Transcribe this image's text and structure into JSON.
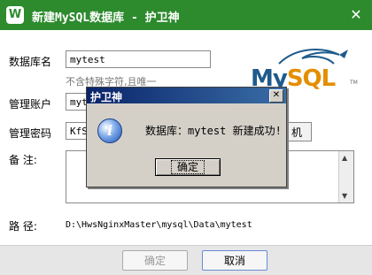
{
  "window": {
    "title": "新建MySQL数据库 - 护卫神",
    "logo_glyph": "W",
    "close_glyph": "✕"
  },
  "form": {
    "db_name_label": "数据库名",
    "db_name_value": "mytest",
    "db_name_hint": "不含特殊字符,且唯一",
    "user_label": "管理账户",
    "user_value": "myte",
    "password_label": "管理密码",
    "password_value": "KfS",
    "generate_label": "机",
    "remark_label": "备  注:",
    "path_label": "路  径:",
    "path_value": "D:\\HwsNginxMaster\\mysql\\Data\\mytest"
  },
  "logo": {
    "my": "My",
    "sql": "SQL",
    "tm": "TM"
  },
  "buttons": {
    "ok": "确定",
    "cancel": "取消"
  },
  "dialog": {
    "title": "护卫神",
    "message": "数据库：mytest 新建成功!",
    "ok": "确定",
    "icon": "info-icon",
    "close_glyph": "✕"
  },
  "colors": {
    "titlebar": "#2d8a2d",
    "dialog_title": "#0a246a",
    "mysql_blue": "#1f5a8c",
    "mysql_orange": "#e48e00"
  }
}
